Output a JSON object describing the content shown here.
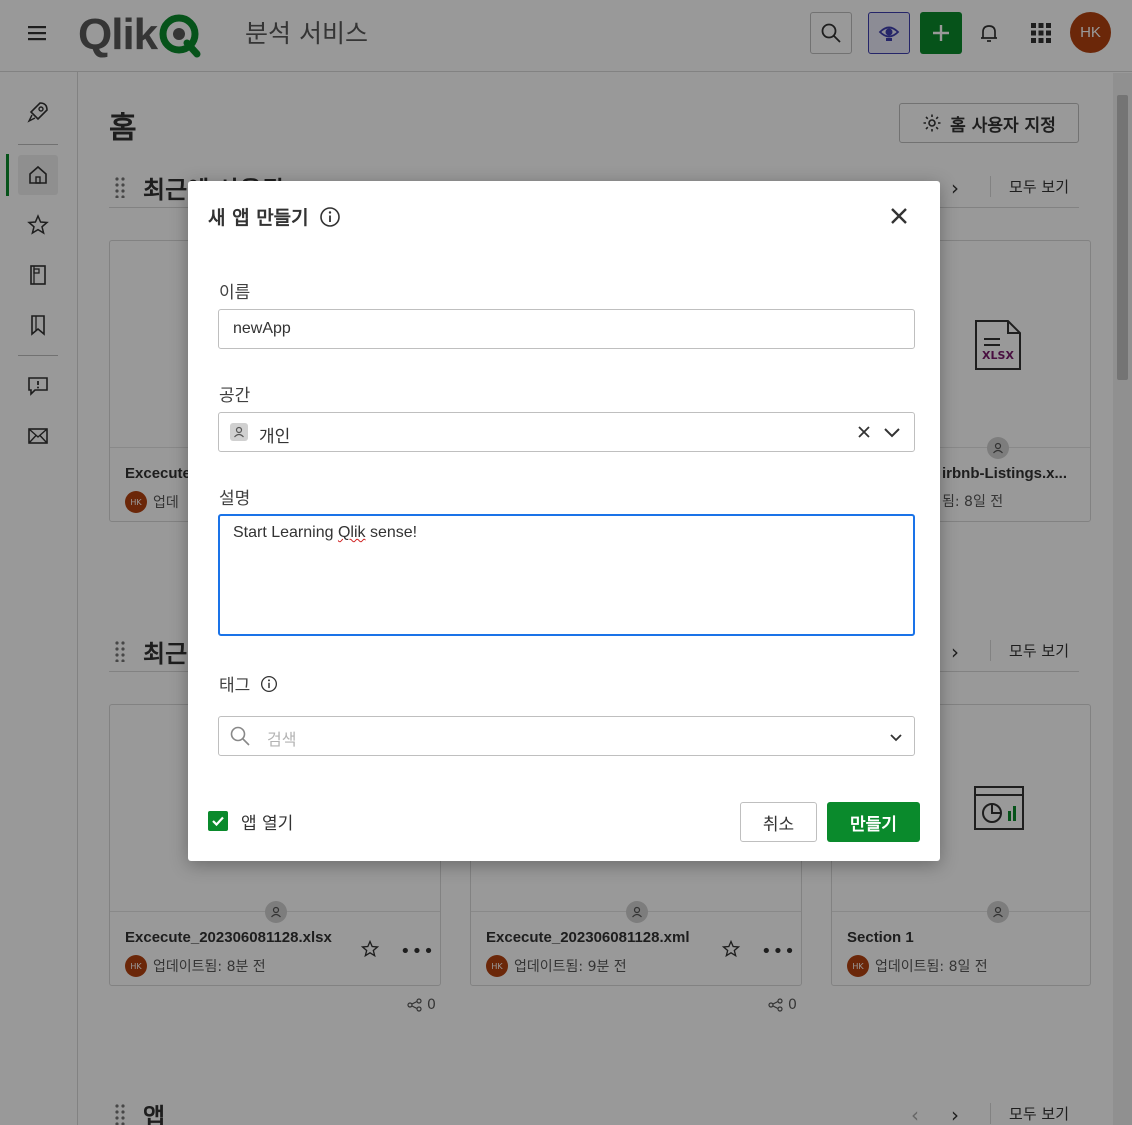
{
  "topbar": {
    "logo": "Qlik",
    "service_title": "분석 서비스",
    "avatar_initials": "HK",
    "brand_color": "#0a8a2c",
    "avatar_color": "#b2410f"
  },
  "rail": {
    "items": [
      "rocket-icon",
      "home-icon",
      "star-icon",
      "catalog-icon",
      "bookmark-icon",
      "feedback-icon",
      "mail-icon"
    ]
  },
  "main": {
    "page_title": "홈",
    "customize_label": "홈 사용자 지정",
    "see_all": "모두 보기",
    "sections": [
      {
        "title": "최근에 사용됨"
      },
      {
        "title": "최근"
      },
      {
        "title": "앱"
      }
    ],
    "row1_cards": [
      {
        "title": "Excecute",
        "meta": "업데"
      },
      {
        "title": "irbnb-Listings.x...",
        "meta": "됨: 8일 전",
        "icon_label": "XLSX"
      }
    ],
    "row2_cards": [
      {
        "title": "Excecute_202306081128.xlsx",
        "avatar": "HK",
        "meta": "업데이트됨: 8분 전",
        "shares": "0"
      },
      {
        "title": "Excecute_202306081128.xml",
        "avatar": "HK",
        "meta": "업데이트됨: 9분 전",
        "shares": "0"
      },
      {
        "title": "Section 1",
        "avatar": "HK",
        "meta": "업데이트됨: 8일 전"
      }
    ]
  },
  "dialog": {
    "title": "새 앱 만들기",
    "name_label": "이름",
    "name_value": "newApp",
    "space_label": "공간",
    "space_value": "개인",
    "description_label": "설명",
    "description_pre": "Start Learning ",
    "description_misspelled": "Qlik",
    "description_post": " sense!",
    "tags_label": "태그",
    "tags_placeholder": "검색",
    "open_app_label": "앱 열기",
    "open_app_checked": true,
    "cancel_label": "취소",
    "create_label": "만들기",
    "focus_color": "#1a73e8"
  }
}
